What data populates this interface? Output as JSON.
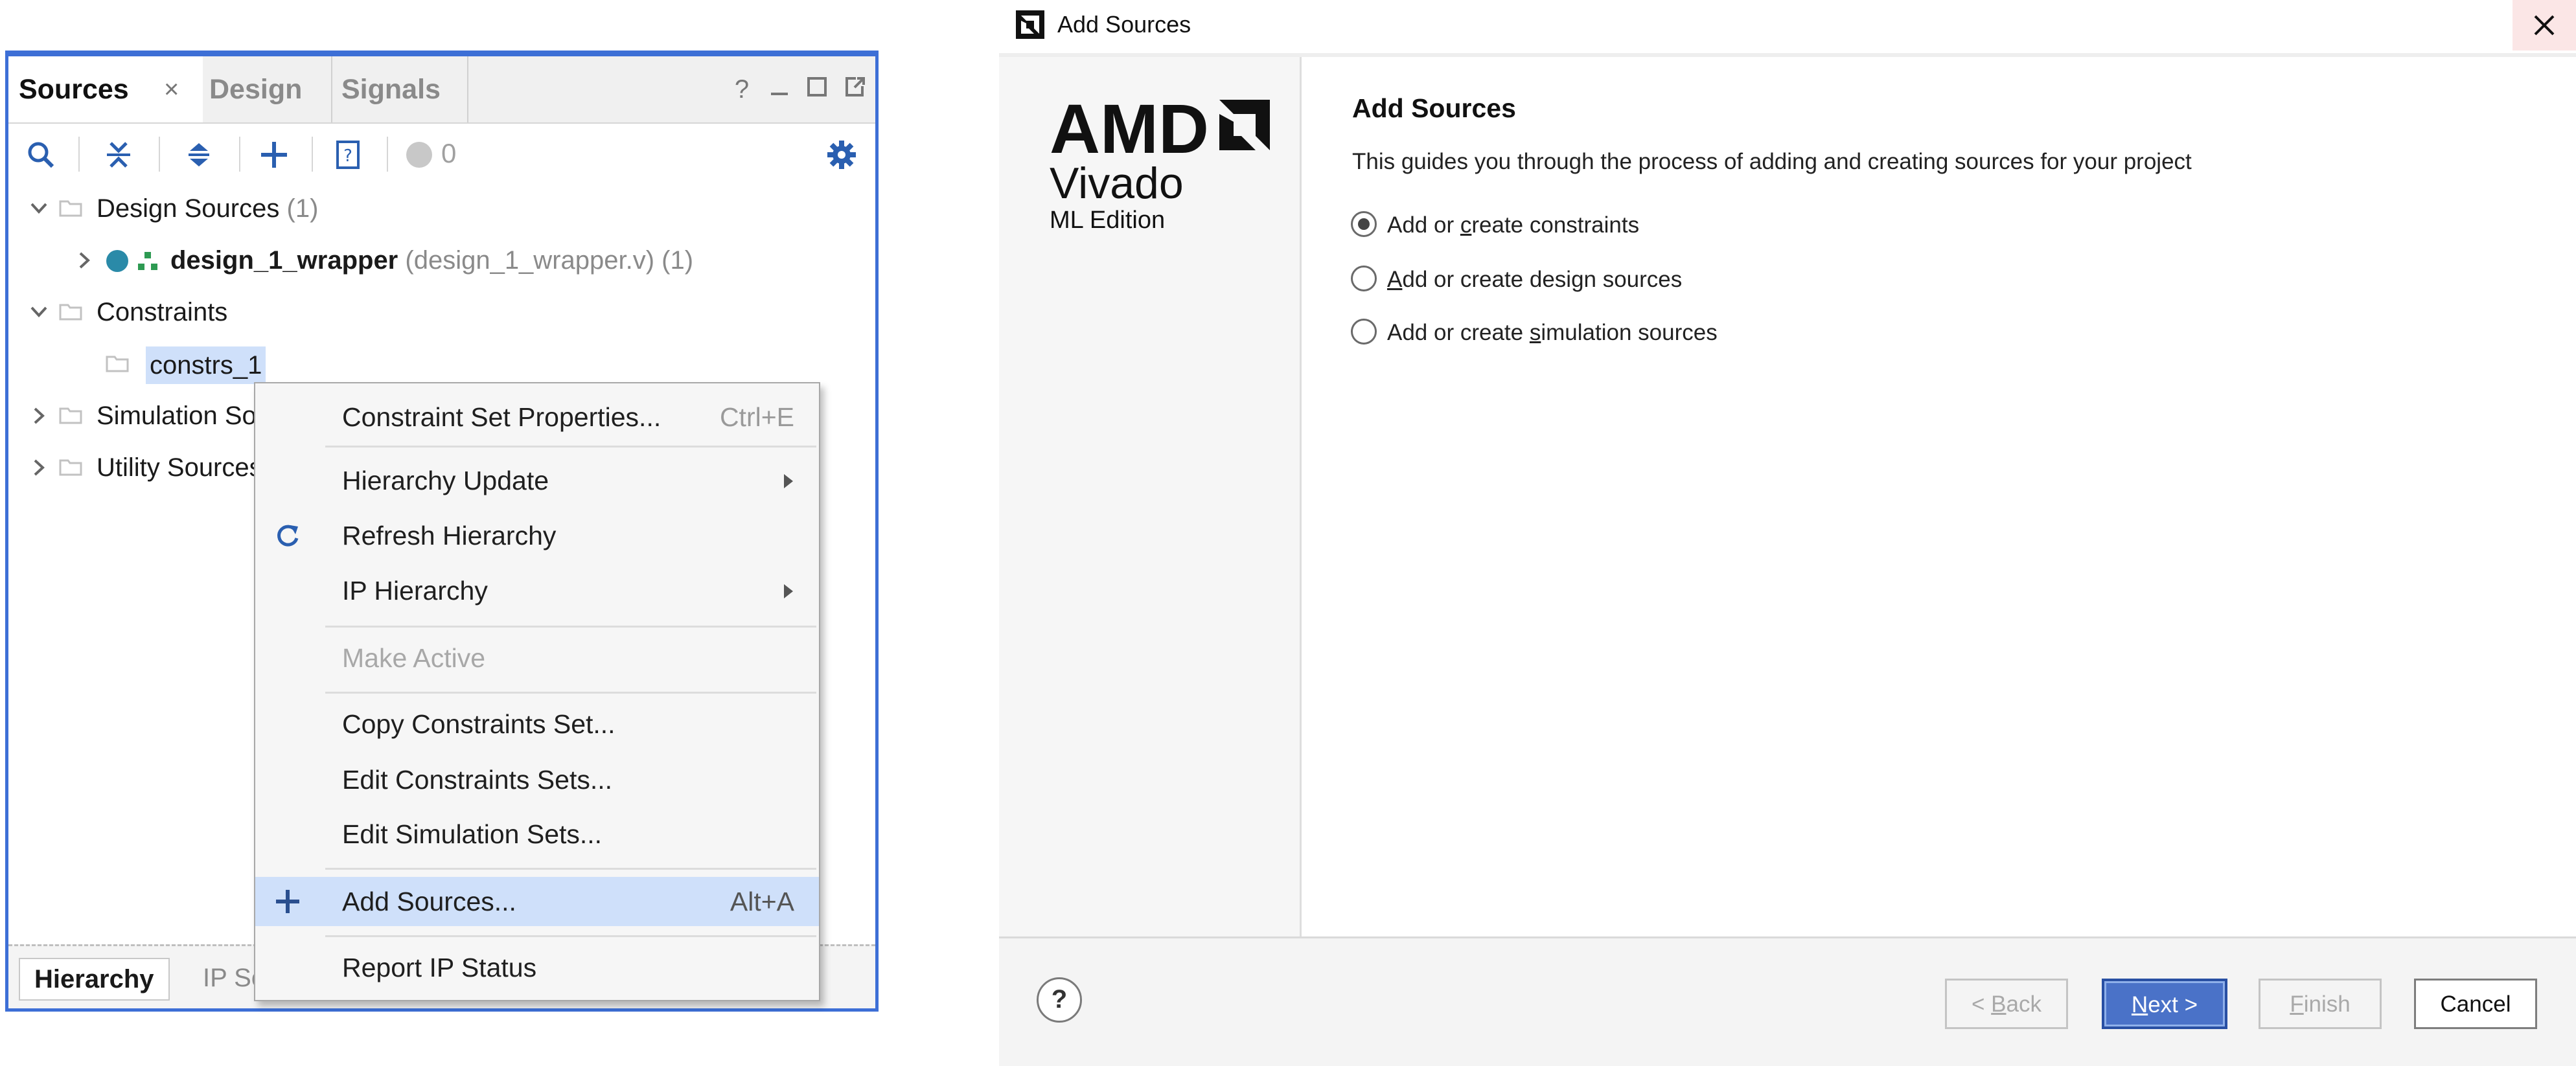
{
  "sources_panel": {
    "tabs": [
      "Sources",
      "Design",
      "Signals"
    ],
    "tab_close": "×",
    "window_controls": [
      "?",
      "_",
      "□",
      "↗"
    ],
    "message_count": "0",
    "tree": {
      "design_sources": {
        "label": "Design Sources",
        "count": "(1)"
      },
      "wrapper": {
        "label": "design_1_wrapper",
        "detail": "(design_1_wrapper.v) (1)"
      },
      "constraints": {
        "label": "Constraints"
      },
      "constrs": {
        "label": "constrs_1"
      },
      "simulation": {
        "label": "Simulation So"
      },
      "utility": {
        "label": "Utility Sources"
      }
    },
    "bottom_tabs": [
      "Hierarchy",
      "IP So"
    ]
  },
  "context_menu": {
    "items": [
      {
        "label": "Constraint Set Properties...",
        "shortcut": "Ctrl+E"
      },
      {
        "label": "Hierarchy Update"
      },
      {
        "label": "Refresh Hierarchy",
        "icon": "refresh-icon"
      },
      {
        "label": "IP Hierarchy"
      },
      {
        "label": "Make Active",
        "disabled": true
      },
      {
        "label": "Copy Constraints Set..."
      },
      {
        "label": "Edit Constraints Sets..."
      },
      {
        "label": "Edit Simulation Sets..."
      },
      {
        "label": "Add Sources...",
        "shortcut": "Alt+A",
        "icon": "plus-icon",
        "highlighted": true
      },
      {
        "label": "Report IP Status"
      }
    ]
  },
  "dialog": {
    "title": "Add Sources",
    "logo": {
      "brand": "AMD",
      "product": "Vivado",
      "edition": "ML Edition"
    },
    "heading": "Add Sources",
    "description": "This guides you through the process of adding and creating sources for your project",
    "options": [
      {
        "pre": "Add or ",
        "key": "c",
        "post": "reate constraints",
        "selected": true
      },
      {
        "pre": "",
        "key": "A",
        "post": "dd or create design sources",
        "selected": false
      },
      {
        "pre": "Add or create ",
        "key": "s",
        "post": "imulation sources",
        "selected": false
      }
    ],
    "buttons": {
      "help": "?",
      "back": {
        "pre": "< ",
        "key": "B",
        "post": "ack"
      },
      "next": {
        "pre": "",
        "key": "N",
        "post": "ext >"
      },
      "finish": {
        "pre": "",
        "key": "F",
        "post": "inish"
      },
      "cancel": "Cancel"
    },
    "accent_color": "#4a72c8"
  }
}
